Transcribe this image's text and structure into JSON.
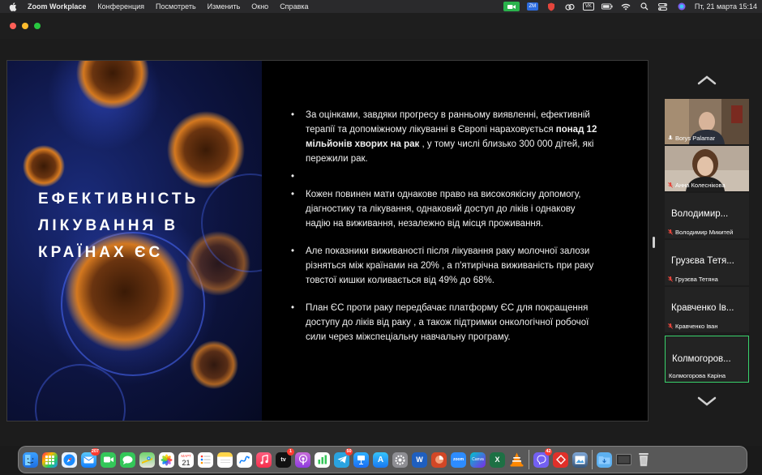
{
  "menubar": {
    "app_name": "Zoom Workplace",
    "menus": [
      "Конференция",
      "Посмотреть",
      "Изменить",
      "Окно",
      "Справка"
    ],
    "tray_labels": {
      "zm": "ZM",
      "vk": "VK"
    },
    "clock": "Пт, 21 марта  15:14"
  },
  "slide": {
    "title_lines": [
      "ЕФЕКТИВНІСТЬ",
      "ЛІКУВАННЯ В",
      "КРАЇНАХ ЄС"
    ],
    "bullets": [
      {
        "pre": "За оцінками, завдяки прогресу в ранньому виявленні, ефективній терапії та допоміжному лікуванні в Європі нараховується ",
        "bold": "понад 12 мільйонів хворих на рак",
        "post": " , у тому числі близько 300 000 дітей, які пережили рак."
      },
      {
        "pre": "Кожен повинен мати однакове право на високоякісну допомогу, діагностику та лікування, однаковий доступ до ліків і однакову надію на виживання, незалежно від місця проживання.",
        "bold": "",
        "post": ""
      },
      {
        "pre": "Але  показники виживаності після лікування раку молочної залози різняться між країнами на 20%  , а  п'ятирічна виживаність при раку товстої кишки коливається від 49% до 68%.",
        "bold": "",
        "post": ""
      },
      {
        "pre": "План ЄС проти раку передбачає  платформу ЄС для покращення доступу до ліків від раку  , а також підтримки онкологічної робочої сили через  міжспеціальну навчальну програму.",
        "bold": "",
        "post": ""
      }
    ]
  },
  "gallery": {
    "participants": [
      {
        "name": "Borys Palamar",
        "big_name": "",
        "video": true,
        "muted": false,
        "active": false
      },
      {
        "name": "Анна Колеснікова",
        "big_name": "",
        "video": true,
        "muted": true,
        "active": false
      },
      {
        "name": "Володимир Микитей",
        "big_name": "Володимир...",
        "video": false,
        "muted": true,
        "active": false
      },
      {
        "name": "Грузєва Тетяна",
        "big_name": "Грузєва Тетя...",
        "video": false,
        "muted": true,
        "active": false
      },
      {
        "name": "Кравченко Іван",
        "big_name": "Кравченко Ів...",
        "video": false,
        "muted": true,
        "active": false
      },
      {
        "name": "Колмогорова Каріна",
        "big_name": "Колмогоров...",
        "video": false,
        "muted": false,
        "active": true
      }
    ]
  },
  "dock": {
    "calendar": {
      "month": "МАРТ",
      "day": "21"
    },
    "badges": {
      "mail": "207",
      "tv": "1",
      "telegram": "50",
      "viber": "42"
    },
    "labels": {
      "tv": "tv",
      "zoom": "zoom",
      "canva": "Canva",
      "word": "W",
      "excel": "X",
      "appstore": "A"
    }
  },
  "colors": {
    "active_speaker": "#39d26b",
    "mic_muted": "#e5453c",
    "zoom_tray": "#2ab24c"
  }
}
